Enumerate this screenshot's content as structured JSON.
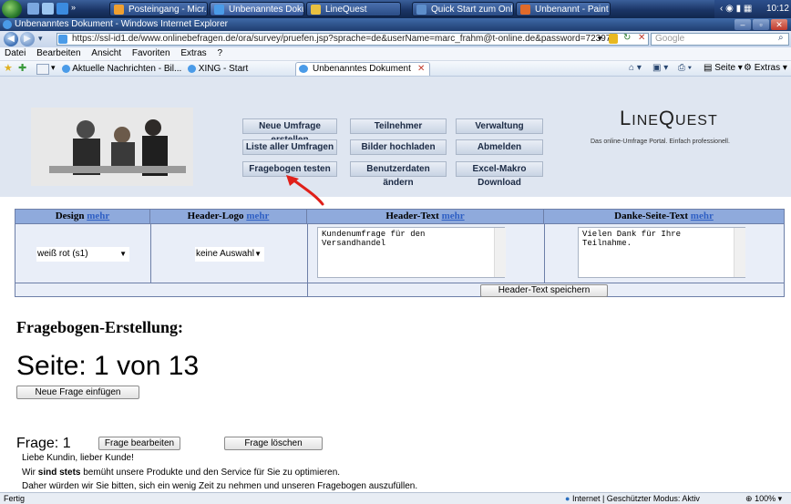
{
  "taskbar": {
    "tasks": [
      {
        "label": "Posteingang - Micr..."
      },
      {
        "label": "Unbenanntes Doku..."
      },
      {
        "label": "LineQuest"
      },
      {
        "label": "Quick Start zum Onl..."
      },
      {
        "label": "Unbenannt - Paint"
      }
    ],
    "clock": "10:12"
  },
  "window": {
    "title": "Unbenanntes Dokument - Windows Internet Explorer"
  },
  "address": {
    "url": "https://ssl-id1.de/www.onlinebefragen.de/ora/survey/pruefen.jsp?sprache=de&userName=marc_frahm@t-online.de&password=723973",
    "search_placeholder": "Google"
  },
  "menu": [
    "Datei",
    "Bearbeiten",
    "Ansicht",
    "Favoriten",
    "Extras",
    "?"
  ],
  "favorites": {
    "items": [
      "Aktuelle Nachrichten - Bil...",
      "XING - Start"
    ],
    "active_tab": "Unbenanntes Dokument",
    "tools": [
      "Seite",
      "Extras"
    ]
  },
  "header": {
    "buttons_col1": [
      "Neue Umfrage erstellen",
      "Liste aller Umfragen",
      "Fragebogen testen"
    ],
    "buttons_col2": [
      "Teilnehmer",
      "Bilder hochladen",
      "Benutzerdaten ändern"
    ],
    "buttons_col3": [
      "Verwaltung",
      "Abmelden",
      "Excel-Makro Download"
    ],
    "logo": "LINEQUEST",
    "logo_first": "L",
    "logo_mid": "INE",
    "logo_q": "Q",
    "logo_end": "UEST",
    "tagline": "Das online-Umfrage Portal. Einfach professionell."
  },
  "settings": {
    "columns": [
      {
        "label": "Design",
        "more": "mehr"
      },
      {
        "label": "Header-Logo",
        "more": "mehr"
      },
      {
        "label": "Header-Text",
        "more": "mehr"
      },
      {
        "label": "Danke-Seite-Text",
        "more": "mehr"
      }
    ],
    "design_value": "weiß rot (s1)",
    "logo_value": "keine Auswahl",
    "header_text": "Kundenumfrage für den\nVersandhandel",
    "thanks_text": "Vielen Dank für Ihre\nTeilnahme.",
    "save_button": "Header-Text speichern"
  },
  "content": {
    "heading": "Fragebogen-Erstellung:",
    "page_indicator": "Seite: 1 von 13",
    "insert_button": "Neue Frage einfügen",
    "question_label": "Frage: 1",
    "edit_button": "Frage bearbeiten",
    "delete_button": "Frage löschen",
    "line1": "Liebe Kundin, lieber Kunde!",
    "line2_pre": "Wir ",
    "line2_bold": "sind stets",
    "line2_post": " bemüht unsere Produkte und den Service für Sie zu optimieren.",
    "line3": "Daher würden wir Sie bitten, sich ein wenig Zeit zu nehmen und unseren Fragebogen auszufüllen."
  },
  "status": {
    "left": "Fertig",
    "zone": "Internet | Geschützter Modus: Aktiv",
    "zoom": "100%"
  },
  "colors": {
    "table_header": "#8faadc",
    "link": "#2e5fc4",
    "annotation": "#e0201a"
  }
}
